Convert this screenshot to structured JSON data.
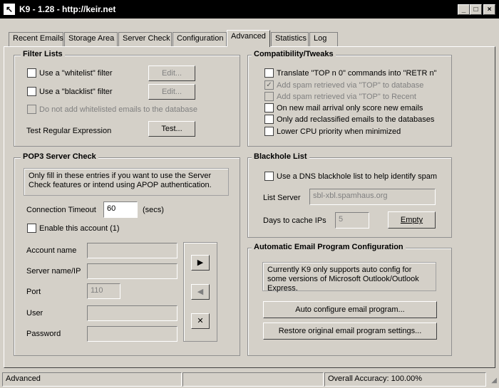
{
  "window": {
    "title": "K9 - 1.28 - http://keir.net",
    "icon": "k9-app-icon",
    "controls": {
      "minimize": "_",
      "maximize": "□",
      "close": "×"
    }
  },
  "tabs": [
    "Recent Emails",
    "Storage Area",
    "Server Check",
    "Configuration",
    "Advanced",
    "Statistics",
    "Log"
  ],
  "active_tab": "Advanced",
  "filter_lists": {
    "title": "Filter Lists",
    "whitelist_label": "Use a \"whitelist\" filter",
    "whitelist_checked": false,
    "whitelist_edit": "Edit...",
    "blacklist_label": "Use a \"blacklist\" filter",
    "blacklist_checked": false,
    "blacklist_edit": "Edit...",
    "no_add_whitelisted_label": "Do not add whitelisted emails to the database",
    "test_regex_label": "Test Regular Expression",
    "test_button": "Test..."
  },
  "compat": {
    "title": "Compatibility/Tweaks",
    "items": [
      {
        "label": "Translate \"TOP n 0\" commands into \"RETR n\"",
        "checked": false,
        "disabled": false
      },
      {
        "label": "Add spam retrieved via \"TOP\" to database",
        "checked": true,
        "disabled": true
      },
      {
        "label": "Add spam retrieved via \"TOP\" to Recent",
        "checked": false,
        "disabled": true
      },
      {
        "label": "On new mail arrival only score new emails",
        "checked": false,
        "disabled": false
      },
      {
        "label": "Only add reclassified emails to the databases",
        "checked": false,
        "disabled": false
      },
      {
        "label": "Lower CPU priority when minimized",
        "checked": false,
        "disabled": false
      }
    ]
  },
  "pop3": {
    "title": "POP3 Server Check",
    "note": "Only fill in these entries if you want to use the Server Check features or intend using APOP authentication.",
    "timeout_label": "Connection Timeout",
    "timeout_value": "60",
    "timeout_unit": "(secs)",
    "enable_label": "Enable this account (1)",
    "account_name_label": "Account name",
    "server_label": "Server name/IP",
    "port_label": "Port",
    "port_value": "110",
    "user_label": "User",
    "password_label": "Password",
    "nav_next": "▶",
    "nav_prev": "◀",
    "nav_delete": "✕"
  },
  "blackhole": {
    "title": "Blackhole List",
    "use_label": "Use a DNS blackhole list to help identify spam",
    "list_server_label": "List Server",
    "list_server_value": "sbl-xbl.spamhaus.org",
    "days_label": "Days to cache IPs",
    "days_value": "5",
    "empty_button": "Empty"
  },
  "auto_config": {
    "title": "Automatic Email Program Configuration",
    "note": "Currently K9 only supports auto config for some versions of Microsoft Outlook/Outlook Express.",
    "auto_button": "Auto configure email program...",
    "restore_button": "Restore original email program settings..."
  },
  "status": {
    "left": "Advanced",
    "middle": "",
    "accuracy": "Overall Accuracy: 100.00%"
  }
}
